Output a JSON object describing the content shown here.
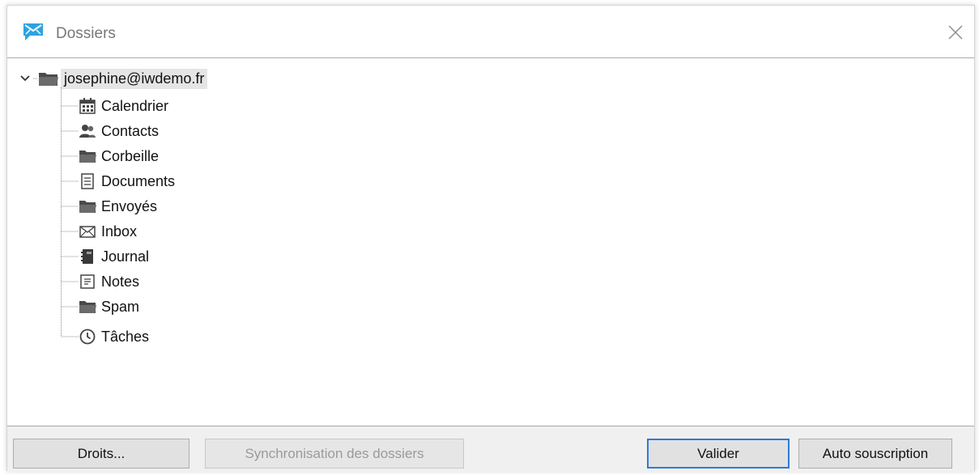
{
  "window": {
    "title": "Dossiers",
    "close_glyph": "×"
  },
  "tree": {
    "root": {
      "label": "josephine@iwdemo.fr",
      "icon": "folder-icon",
      "expanded": true
    },
    "items": [
      {
        "label": "Calendrier",
        "icon": "calendar-icon"
      },
      {
        "label": "Contacts",
        "icon": "contacts-icon"
      },
      {
        "label": "Corbeille",
        "icon": "folder-icon"
      },
      {
        "label": "Documents",
        "icon": "document-icon"
      },
      {
        "label": "Envoyés",
        "icon": "folder-icon"
      },
      {
        "label": "Inbox",
        "icon": "envelope-icon"
      },
      {
        "label": "Journal",
        "icon": "journal-icon"
      },
      {
        "label": "Notes",
        "icon": "notes-icon"
      },
      {
        "label": "Spam",
        "icon": "folder-icon"
      },
      {
        "label": "Tâches",
        "icon": "clock-icon"
      }
    ]
  },
  "footer": {
    "rights_label": "Droits...",
    "sync_label": "Synchronisation des dossiers",
    "validate_label": "Valider",
    "auto_subscribe_label": "Auto souscription"
  },
  "colors": {
    "app_icon": "#2ba3e3",
    "folder": "#4a4a4a",
    "default_button_border": "#2f7ad6"
  }
}
